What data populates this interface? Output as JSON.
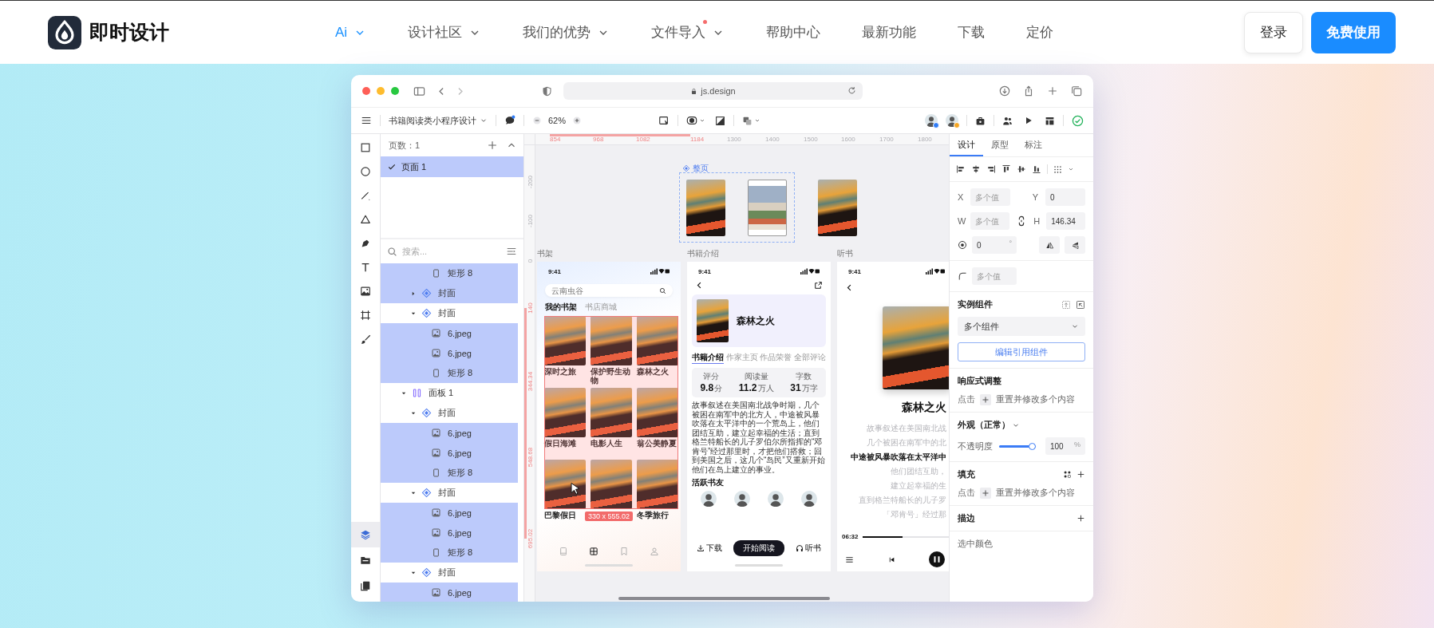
{
  "header": {
    "logo_text": "即时设计",
    "nav": [
      {
        "label": "Ai",
        "dropdown": true,
        "dot": false,
        "selected": true
      },
      {
        "label": "设计社区",
        "dropdown": true,
        "dot": false,
        "selected": false
      },
      {
        "label": "我们的优势",
        "dropdown": true,
        "dot": false,
        "selected": false
      },
      {
        "label": "文件导入",
        "dropdown": true,
        "dot": true,
        "selected": false
      },
      {
        "label": "帮助中心",
        "dropdown": false,
        "dot": false,
        "selected": false
      },
      {
        "label": "最新功能",
        "dropdown": false,
        "dot": false,
        "selected": false
      },
      {
        "label": "下载",
        "dropdown": false,
        "dot": false,
        "selected": false
      },
      {
        "label": "定价",
        "dropdown": false,
        "dot": false,
        "selected": false
      }
    ],
    "login": "登录",
    "signup": "免费使用"
  },
  "browser": {
    "url": "js.design"
  },
  "toolbar": {
    "file_name": "书籍阅读类小程序设计",
    "zoom": "62%",
    "collaborators": [
      {
        "color": "#2f7cf6"
      },
      {
        "color": "#f5a623"
      }
    ]
  },
  "tools": [
    {
      "kind": "rect"
    },
    {
      "kind": "ellipse"
    },
    {
      "kind": "line"
    },
    {
      "kind": "triangle"
    },
    {
      "kind": "pen"
    },
    {
      "kind": "text"
    },
    {
      "kind": "image"
    },
    {
      "kind": "frame"
    },
    {
      "kind": "brush"
    }
  ],
  "panel_tabs": [
    {
      "kind": "layers",
      "selected": true
    },
    {
      "kind": "assets",
      "selected": false
    },
    {
      "kind": "components",
      "selected": false
    }
  ],
  "layers_panel": {
    "page_count": "页数：1",
    "pages": [
      {
        "name": "页面 1",
        "selected": true
      }
    ],
    "search_placeholder": "搜索...",
    "tree": [
      {
        "children": [
          {
            "children": [
              {
                "name": "矩形 8",
                "kind": "rect",
                "selected": true
              }
            ]
          },
          {
            "name": "封面",
            "kind": "component",
            "expanded": false,
            "selected": true
          },
          {
            "name": "封面",
            "kind": "component",
            "expanded": true,
            "selected": false,
            "children": [
              {
                "name": "6.jpeg",
                "kind": "image",
                "selected": true
              },
              {
                "name": "6.jpeg",
                "kind": "image",
                "selected": true
              },
              {
                "name": "矩形 8",
                "kind": "rect",
                "selected": true
              }
            ]
          }
        ]
      },
      {
        "name": "面板 1",
        "kind": "frame",
        "expanded": true,
        "selected": false,
        "children": [
          {
            "name": "封面",
            "kind": "component",
            "expanded": true,
            "selected": false,
            "children": [
              {
                "name": "6.jpeg",
                "kind": "image",
                "selected": true
              },
              {
                "name": "6.jpeg",
                "kind": "image",
                "selected": true
              },
              {
                "name": "矩形 8",
                "kind": "rect",
                "selected": true
              }
            ]
          },
          {
            "name": "封面",
            "kind": "component",
            "expanded": true,
            "selected": false,
            "children": [
              {
                "name": "6.jpeg",
                "kind": "image",
                "selected": true
              },
              {
                "name": "6.jpeg",
                "kind": "image",
                "selected": true
              },
              {
                "name": "矩形 8",
                "kind": "rect",
                "selected": true
              }
            ]
          },
          {
            "name": "封面",
            "kind": "component",
            "expanded": true,
            "selected": false,
            "children": [
              {
                "name": "6.jpeg",
                "kind": "image",
                "selected": true
              }
            ]
          }
        ]
      }
    ]
  },
  "canvas": {
    "ruler_x": [
      {
        "label": "854",
        "highlighted": true
      },
      {
        "label": "968",
        "highlighted": true
      },
      {
        "label": "1082",
        "highlighted": true
      },
      {
        "label": "1184",
        "highlighted": true
      },
      {
        "label": "1300",
        "highlighted": false
      },
      {
        "label": "1400",
        "highlighted": false
      },
      {
        "label": "1500",
        "highlighted": false
      },
      {
        "label": "1600",
        "highlighted": false
      },
      {
        "label": "1700",
        "highlighted": false
      },
      {
        "label": "1800",
        "highlighted": false
      }
    ],
    "ruler_y": [
      {
        "label": "-200",
        "highlighted": false
      },
      {
        "label": "-100",
        "highlighted": false
      },
      {
        "label": "0",
        "highlighted": false
      },
      {
        "label": "140",
        "highlighted": true
      },
      {
        "label": "344.34",
        "highlighted": true
      },
      {
        "label": "548.68",
        "highlighted": true
      },
      {
        "label": "695.02",
        "highlighted": true
      }
    ],
    "component": {
      "label": "整页",
      "thumbnails": [
        {
          "kind": "fire"
        },
        {
          "kind": "crowd"
        },
        {
          "kind": "fire"
        }
      ]
    },
    "frames": [
      {
        "kind": "shelf",
        "title": "书架",
        "time": "9:41",
        "search_placeholder": "云南虫谷",
        "tabs": [
          {
            "label": "我的书架",
            "selected": true
          },
          {
            "label": "书店商城",
            "selected": false
          }
        ],
        "books": [
          {
            "kind": "fire",
            "title": "深时之旅"
          },
          {
            "kind": "fire",
            "title": "保护野生动物"
          },
          {
            "kind": "fire",
            "title": "森林之火"
          },
          {
            "kind": "fire",
            "title": "假日海滩"
          },
          {
            "kind": "fire",
            "title": "电影人生"
          },
          {
            "kind": "fire",
            "title": "翁公美静夏"
          },
          {
            "kind": "fire",
            "title": "巴黎假日"
          },
          {
            "kind": "fire"
          },
          {
            "kind": "fire",
            "title": "冬季旅行"
          }
        ],
        "selection_size": "330 x 555.02",
        "nav": [
          {
            "kind": "book",
            "selected": false
          },
          {
            "kind": "grid",
            "selected": true
          },
          {
            "kind": "bookmark",
            "selected": false
          },
          {
            "kind": "user",
            "selected": false
          }
        ]
      },
      {
        "kind": "detail",
        "title": "书籍介绍",
        "time": "9:41",
        "book_title": "森林之火",
        "tabs": [
          {
            "label": "书籍介绍",
            "selected": true
          },
          {
            "label": "作家主页",
            "selected": false
          },
          {
            "label": "作品荣誉",
            "selected": false
          },
          {
            "label": "全部评论",
            "selected": false
          }
        ],
        "stats": [
          {
            "label": "评分",
            "value": "9.8",
            "unit": "分"
          },
          {
            "label": "阅读量",
            "value": "11.2",
            "unit": "万人"
          },
          {
            "label": "字数",
            "value": "31",
            "unit": "万字"
          }
        ],
        "summary": "故事叙述在美国南北战争时期，几个被困在南军中的北方人，中途被风暴吹落在太平洋中的一个荒岛上，他们团结互助，建立起幸福的生活；直到格兰特船长的儿子罗伯尔所指挥的“邓肯号”经过那里时，才把他们搭救；回到美国之后，这几个“岛民”又重新开始他们在岛上建立的事业。",
        "friends_title": "活跃书友",
        "friends": [
          {
            "kind": "photo"
          },
          {
            "kind": "photo"
          },
          {
            "kind": "photo"
          },
          {
            "kind": "photo"
          }
        ],
        "actions": {
          "download": "下载",
          "read": "开始阅读",
          "listen": "听书"
        }
      },
      {
        "kind": "audio",
        "title": "听书",
        "time": "9:41",
        "book_title": "森林之火",
        "lines": [
          {
            "text": "故事叙述在美国南北战",
            "current": false
          },
          {
            "text": "几个被困在南军中的北",
            "current": false
          },
          {
            "text": "中途被风暴吹落在太平洋中",
            "current": true
          },
          {
            "text": "他们团结互助，",
            "current": false
          },
          {
            "text": "建立起幸福的生",
            "current": false
          },
          {
            "text": "直到格兰特船长的儿子罗",
            "current": false
          },
          {
            "text": "「邓肯号」经过那",
            "current": false
          }
        ],
        "elapsed": "06:32",
        "level": 0.45
      }
    ]
  },
  "properties": {
    "tabs": [
      {
        "label": "设计",
        "selected": true
      },
      {
        "label": "原型",
        "selected": false
      },
      {
        "label": "标注",
        "selected": false
      }
    ],
    "position": [
      {
        "label": "X",
        "placeholder": "多个值"
      },
      {
        "label": "Y",
        "value": "0"
      },
      {
        "label": "W",
        "placeholder": "多个值"
      },
      {
        "label": "H",
        "value": "146.34"
      }
    ],
    "rotation": {
      "value": "0",
      "unit": "°"
    },
    "radius": {
      "placeholder": "多个值"
    },
    "instance": {
      "title": "实例组件",
      "select": "多个组件",
      "button": "编辑引用组件"
    },
    "responsive": {
      "title": "响应式调整",
      "hint_before": "点击",
      "hint_after": "重置并修改多个内容"
    },
    "appearance": {
      "title": "外观（正常）",
      "opacity_label": "不透明度",
      "level": 1,
      "opacity_value": "100",
      "unit": "%"
    },
    "fill": {
      "title": "填充",
      "hint_before": "点击",
      "hint_after": "重置并修改多个内容"
    },
    "stroke": {
      "title": "描边"
    },
    "selection_colors": {
      "title": "选中颜色"
    }
  }
}
